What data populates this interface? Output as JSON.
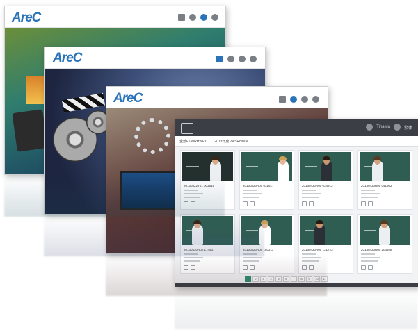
{
  "brand": {
    "logo_text": "AreC"
  },
  "windows": [
    {
      "id": "w1",
      "theme": "classroom-apps"
    },
    {
      "id": "w2",
      "theme": "film-reel"
    },
    {
      "id": "w3",
      "theme": "gears-laptop"
    }
  ],
  "portal": {
    "tabs": [
      "全部PTWRHWRD",
      "2013年度 ZASRHWN"
    ],
    "user": {
      "name": "TinaMa",
      "lang": "繁体"
    },
    "videos": [
      {
        "title": "20130422T01 003515",
        "variant": "dark"
      },
      {
        "title": "20130420R00 031517",
        "variant": "green"
      },
      {
        "title": "20130430R00 034913",
        "variant": "green"
      },
      {
        "title": "20130430R00 041502",
        "variant": "green"
      },
      {
        "title": "20130430R00 174937",
        "variant": "green"
      },
      {
        "title": "20130420R00 180211",
        "variant": "green"
      },
      {
        "title": "20130430R00 131723",
        "variant": "green"
      },
      {
        "title": "20130430R00 204408",
        "variant": "green"
      }
    ],
    "pagination": {
      "current": "1",
      "pages": [
        "1",
        "2",
        "3",
        "4",
        "5",
        "6",
        "7",
        "8",
        "9",
        "10",
        "11"
      ]
    }
  },
  "colors": {
    "accent": "#2a73b8",
    "portal_topbar": "#3b3f45",
    "pager_active": "#2f8f6f"
  }
}
